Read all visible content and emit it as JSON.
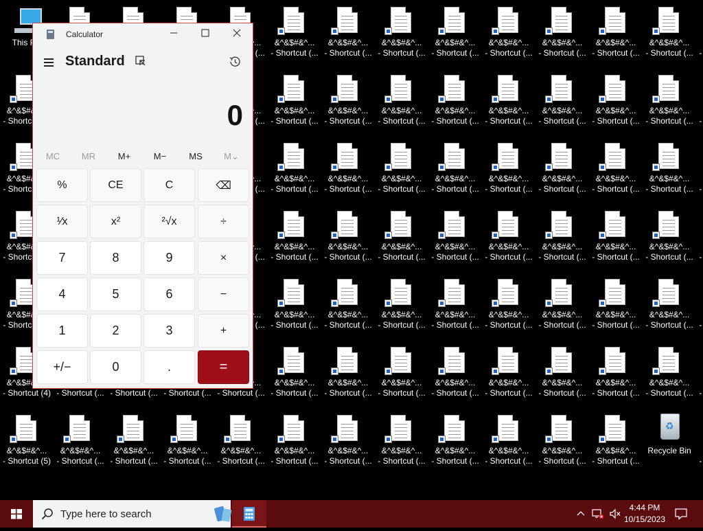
{
  "desktop": {
    "this_pc_label": "This PC",
    "shortcut_line1": "&^&$#&^...",
    "shortcut_line2": "- Shortcut (...",
    "shortcut4_line1": "&^&$#&^...",
    "shortcut4_line2": "- Shortcut (4)",
    "shortcut5_line1": "&^&$#&^...",
    "shortcut5_line2": "- Shortcut (5)",
    "recycle_bin_label": "Recycle Bin"
  },
  "calculator": {
    "title": "Calculator",
    "mode": "Standard",
    "display": "0",
    "memory": [
      "MC",
      "MR",
      "M+",
      "M−",
      "MS",
      "M⌄"
    ],
    "memory_enabled": [
      false,
      false,
      true,
      true,
      true,
      false
    ],
    "keys": [
      [
        "%",
        "CE",
        "C",
        "⌫"
      ],
      [
        "¹⁄x",
        "x²",
        "²√x",
        "÷"
      ],
      [
        "7",
        "8",
        "9",
        "×"
      ],
      [
        "4",
        "5",
        "6",
        "−"
      ],
      [
        "1",
        "2",
        "3",
        "+"
      ],
      [
        "+/−",
        "0",
        ".",
        "="
      ]
    ],
    "accent_color": "#9e0f1a"
  },
  "taskbar": {
    "search_placeholder": "Type here to search",
    "time": "4:44 PM",
    "date": "10/15/2023",
    "color": "#5a0c0e"
  },
  "icons": {
    "start": "windows-logo-icon",
    "search": "magnifier-icon",
    "history": "history-icon",
    "keep_on_top": "keep-on-top-icon"
  }
}
